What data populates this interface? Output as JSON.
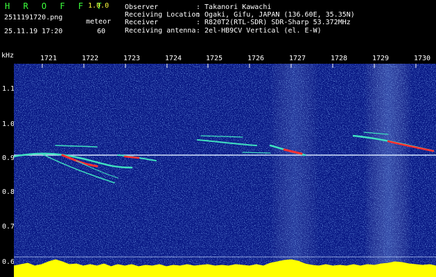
{
  "header": {
    "app_title": "H R O F F T",
    "version": "1.0.0",
    "filename": "2511191720.png",
    "mode": "meteor",
    "datetime": "25.11.19 17:20",
    "count": "60"
  },
  "info": [
    {
      "label": "Observer",
      "value": ": Takanori Kawachi"
    },
    {
      "label": "Receiving Location",
      "value": ": Ogaki, Gifu, JAPAN (136.60E, 35.35N)"
    },
    {
      "label": "Receiver",
      "value": ": R820T2(RTL-SDR) SDR-Sharp 53.372MHz"
    },
    {
      "label": "Receiving antenna",
      "value": ": 2el-HB9CV Vertical (el. E-W)"
    }
  ],
  "spectrogram": {
    "freq_unit": "kHz",
    "freq_ticks": [
      "1.1",
      "1.0",
      "0.9",
      "0.8",
      "0.7",
      "0.6"
    ],
    "time_ticks": [
      "1721",
      "1722",
      "1723",
      "1724",
      "1725",
      "1726",
      "1727",
      "1728",
      "1729",
      "1730"
    ],
    "colors": {
      "background": "#0a1a86",
      "noise_light": "#3a78e0",
      "echo": "#40e0c0",
      "echo_strong": "#ff3030",
      "carrier": "#d8e8ff",
      "noise_floor": "#ffff00"
    }
  }
}
